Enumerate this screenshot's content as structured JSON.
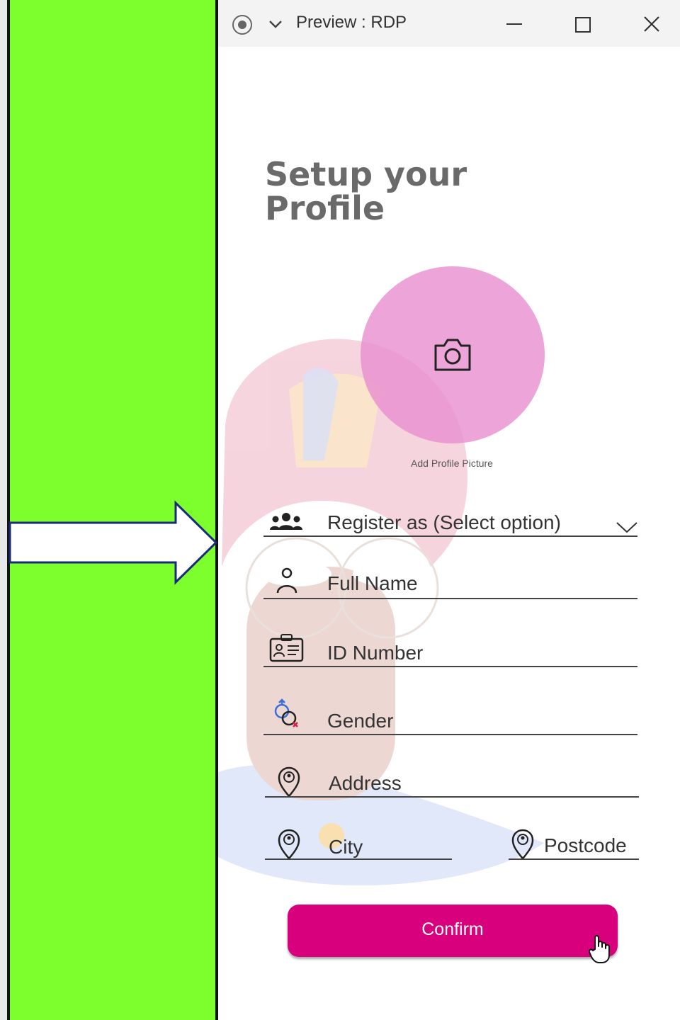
{
  "window": {
    "title": "Preview : RDP"
  },
  "page": {
    "title_line1": "Setup your",
    "title_line2": "Profile",
    "avatar_label": "Add Profile Picture"
  },
  "form": {
    "register_as": "Register as (Select option)",
    "full_name": "Full Name",
    "id_number": "ID Number",
    "gender": "Gender",
    "address": "Address",
    "city": "City",
    "postcode": "Postcode",
    "confirm_label": "Confirm"
  },
  "colors": {
    "side_panel": "#7dff2e",
    "accent": "#d9007e",
    "avatar": "#e88cce"
  },
  "icons": [
    "record-icon",
    "chevron-down-icon",
    "minimize-icon",
    "maximize-icon",
    "close-icon",
    "camera-icon",
    "group-icon",
    "person-icon",
    "id-card-icon",
    "gender-icon",
    "location-pin-icon",
    "right-arrow-icon",
    "hand-cursor-icon"
  ]
}
